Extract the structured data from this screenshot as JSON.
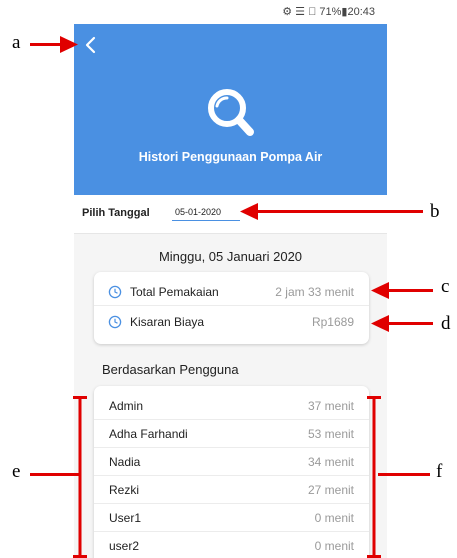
{
  "status_bar": {
    "text": "⚙ ☰ ⃠ 71%▮20:43"
  },
  "header": {
    "back_icon": "chevron-left-icon",
    "main_icon": "search-icon",
    "title": "Histori Penggunaan Pompa Air",
    "bg_color": "#4a90e2"
  },
  "date_picker": {
    "label": "Pilih Tanggal",
    "value": "05-01-2020"
  },
  "date_heading": "Minggu, 05 Januari 2020",
  "summary": [
    {
      "icon": "clock-icon",
      "label": "Total Pemakaian",
      "value": "2 jam 33 menit"
    },
    {
      "icon": "clock-icon",
      "label": "Kisaran Biaya",
      "value": "Rp1689"
    }
  ],
  "users_section": {
    "title": "Berdasarkan Pengguna",
    "rows": [
      {
        "name": "Admin",
        "value": "37 menit"
      },
      {
        "name": "Adha Farhandi",
        "value": "53 menit"
      },
      {
        "name": "Nadia",
        "value": "34 menit"
      },
      {
        "name": "Rezki",
        "value": "27 menit"
      },
      {
        "name": "User1",
        "value": "0 menit"
      },
      {
        "name": "user2",
        "value": "0 menit"
      }
    ]
  },
  "annotations": {
    "a": "a",
    "b": "b",
    "c": "c",
    "d": "d",
    "e": "e",
    "f": "f",
    "color": "#e00000"
  }
}
